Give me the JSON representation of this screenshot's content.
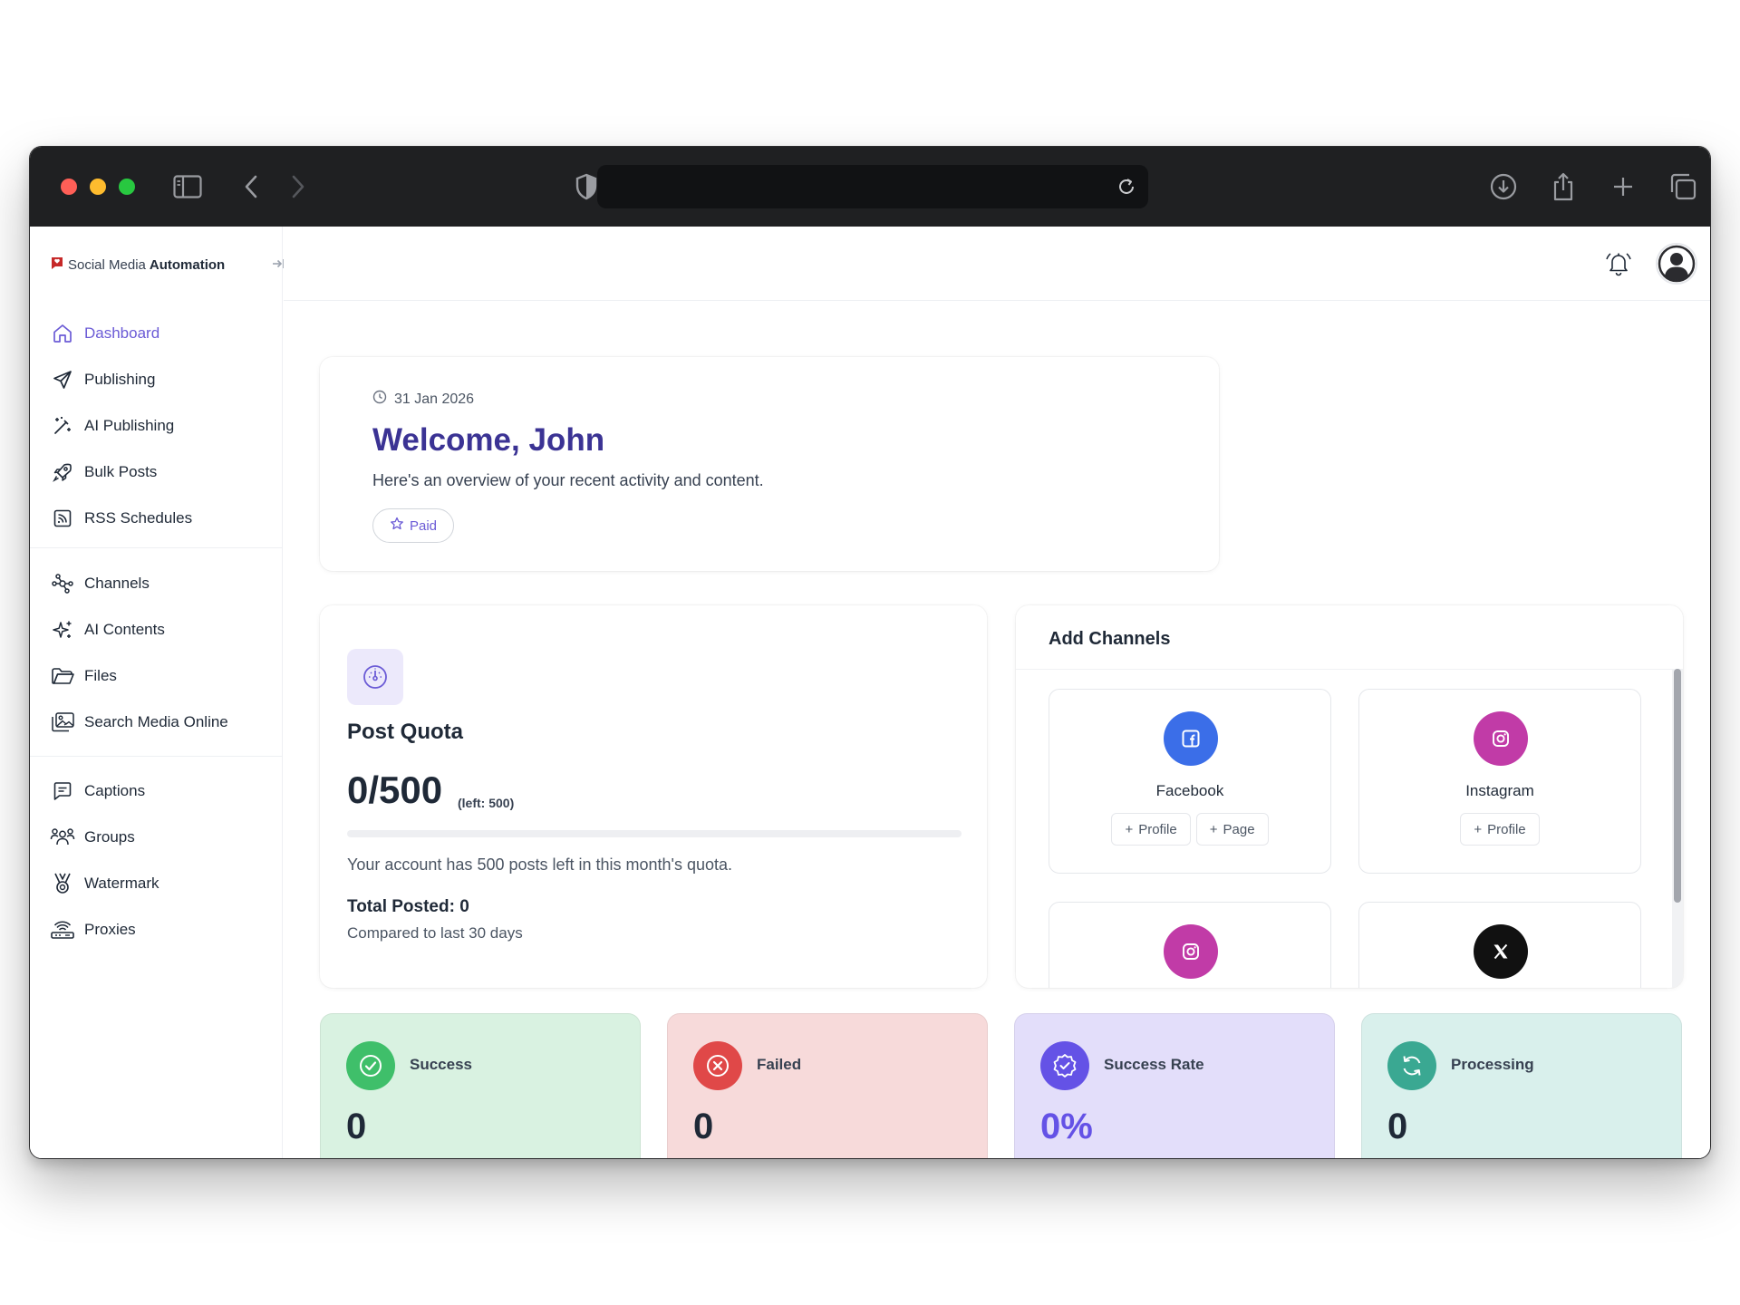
{
  "brand": {
    "name_prefix": "Social Media ",
    "name_bold": "Automation"
  },
  "sidebar": {
    "items": [
      {
        "label": "Dashboard",
        "icon": "home-icon"
      },
      {
        "label": "Publishing",
        "icon": "send-icon"
      },
      {
        "label": "AI Publishing",
        "icon": "magic-wand-icon"
      },
      {
        "label": "Bulk Posts",
        "icon": "rocket-icon"
      },
      {
        "label": "RSS Schedules",
        "icon": "rss-icon"
      },
      {
        "label": "Channels",
        "icon": "network-icon"
      },
      {
        "label": "AI Contents",
        "icon": "sparkles-icon"
      },
      {
        "label": "Files",
        "icon": "folder-icon"
      },
      {
        "label": "Search Media Online",
        "icon": "images-icon"
      },
      {
        "label": "Captions",
        "icon": "message-square-icon"
      },
      {
        "label": "Groups",
        "icon": "users-icon"
      },
      {
        "label": "Watermark",
        "icon": "award-icon"
      },
      {
        "label": "Proxies",
        "icon": "router-icon"
      }
    ],
    "active_color": "#6b5bd6"
  },
  "welcome": {
    "date": "31 Jan 2026",
    "title": "Welcome, John",
    "subtitle": "Here's an overview of your recent activity and content.",
    "plan_badge": "Paid"
  },
  "quota": {
    "title": "Post Quota",
    "value": "0/500",
    "left_label": "(left: 500)",
    "progress_fraction": 0,
    "description": "Your account has 500 posts left in this month's quota.",
    "total_posted": "Total Posted: 0",
    "comparison": "Compared to last 30 days"
  },
  "channels": {
    "title": "Add Channels",
    "cards": [
      {
        "name": "Facebook",
        "color": "#3b6ee8",
        "buttons": [
          "Profile",
          "Page"
        ]
      },
      {
        "name": "Instagram",
        "color": "#c13ba7",
        "buttons": [
          "Profile"
        ]
      },
      {
        "name": "",
        "color": "#c13ba7",
        "buttons": []
      },
      {
        "name": "",
        "color": "#111111",
        "buttons": []
      }
    ]
  },
  "stats": [
    {
      "label": "Success",
      "value": "0",
      "bg": "#d9f2e1",
      "icon_bg": "#3fbf6a"
    },
    {
      "label": "Failed",
      "value": "0",
      "bg": "#f7dada",
      "icon_bg": "#e04848"
    },
    {
      "label": "Success Rate",
      "value": "0%",
      "bg": "#e3defa",
      "icon_bg": "#6452e6",
      "value_color": "#6452e6"
    },
    {
      "label": "Processing",
      "value": "0",
      "bg": "#d9f0ec",
      "icon_bg": "#3aa892"
    }
  ]
}
